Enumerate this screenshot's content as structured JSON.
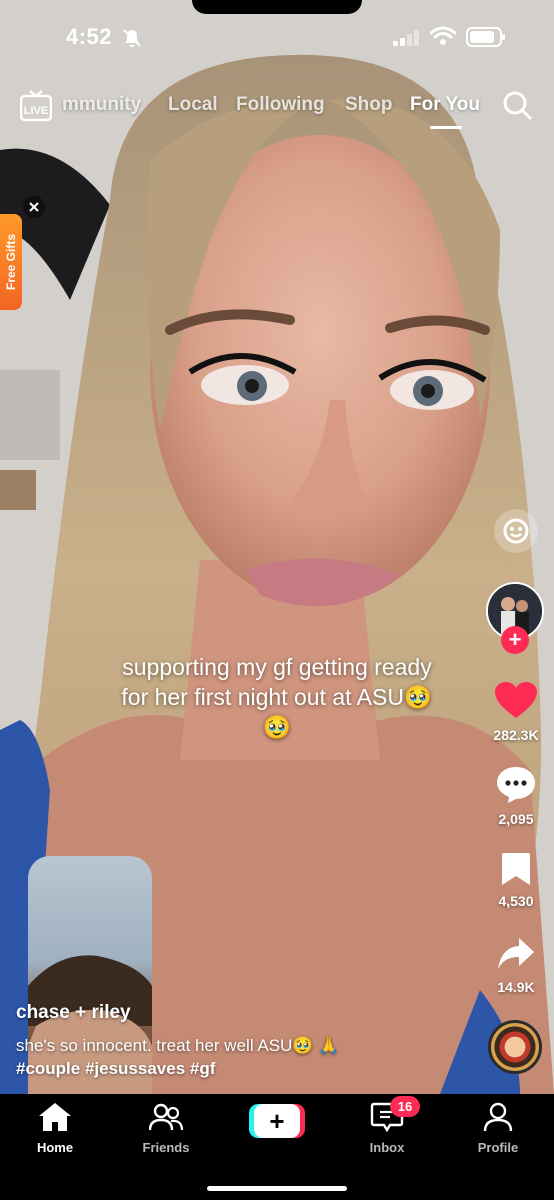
{
  "status_bar": {
    "time": "4:52"
  },
  "top_nav": {
    "live_label": "LIVE",
    "tabs": [
      {
        "label": "mmunity",
        "active": false
      },
      {
        "label": "Local",
        "active": false
      },
      {
        "label": "Following",
        "active": false
      },
      {
        "label": "Shop",
        "active": false
      },
      {
        "label": "For You",
        "active": true
      }
    ]
  },
  "promo": {
    "label": "Free Gifts"
  },
  "video": {
    "overlay_text": "supporting my gf getting ready for her first night out at ASU🥹🥹",
    "author": "chase + riley",
    "description": "she's so innocent. treat her well ASU🥹 🙏",
    "hashtags": "#couple #jesussaves #gf"
  },
  "actions": {
    "likes": "282.3K",
    "comments": "2,095",
    "saves": "4,530",
    "shares": "14.9K",
    "follow_label": "+"
  },
  "bottom_nav": {
    "items": [
      {
        "label": "Home",
        "active": true
      },
      {
        "label": "Friends",
        "active": false
      },
      {
        "label": "",
        "active": false
      },
      {
        "label": "Inbox",
        "active": false
      },
      {
        "label": "Profile",
        "active": false
      }
    ],
    "create_label": "+",
    "inbox_badge": "16"
  },
  "colors": {
    "accent": "#fe2c55",
    "cyan": "#25f4ee",
    "like": "#fe2c55"
  }
}
